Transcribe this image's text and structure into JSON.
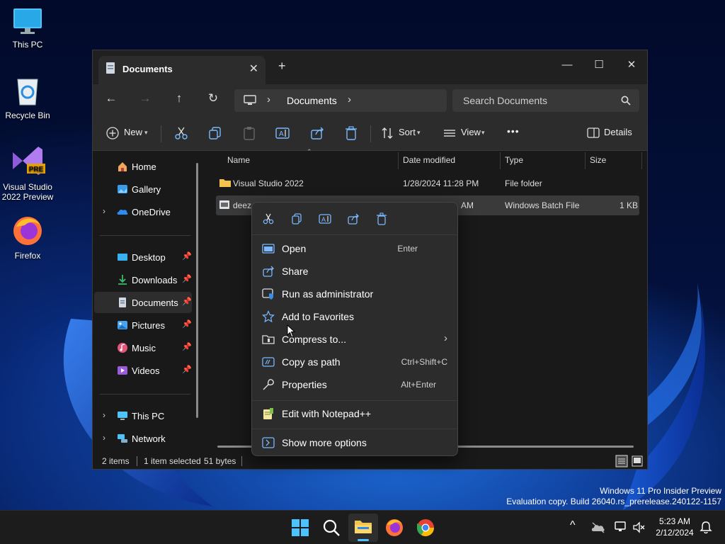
{
  "desktop": {
    "icons": [
      {
        "label": "This PC"
      },
      {
        "label": "Recycle Bin"
      },
      {
        "label": "Visual Studio 2022 Preview",
        "badge": "PRE"
      },
      {
        "label": "Firefox"
      }
    ],
    "watermark": {
      "line1": "Windows 11 Pro Insider Preview",
      "line2": "Evaluation copy. Build 26040.rs_prerelease.240122-1157"
    }
  },
  "window": {
    "tab_title": "Documents",
    "tab_close": "✕",
    "new_tab": "+",
    "controls": {
      "minimize": "—",
      "maximize": "☐",
      "close": "✕"
    },
    "nav": {
      "back": "←",
      "forward": "→",
      "up": "↑",
      "refresh": "↻"
    },
    "address": {
      "separator": "›",
      "current": "Documents"
    },
    "search": {
      "placeholder": "Search Documents"
    },
    "toolbar": {
      "new_label": "New",
      "sort_label": "Sort",
      "view_label": "View",
      "more_label": "•••",
      "details_label": "Details"
    },
    "sidebar": {
      "items": [
        {
          "label": "Home"
        },
        {
          "label": "Gallery"
        },
        {
          "label": "OneDrive"
        },
        {
          "label": "Desktop"
        },
        {
          "label": "Downloads"
        },
        {
          "label": "Documents"
        },
        {
          "label": "Pictures"
        },
        {
          "label": "Music"
        },
        {
          "label": "Videos"
        },
        {
          "label": "This PC"
        },
        {
          "label": "Network"
        }
      ]
    },
    "columns": {
      "name": "Name",
      "date": "Date modified",
      "type": "Type",
      "size": "Size"
    },
    "rows": [
      {
        "name": "Visual Studio 2022",
        "date": "1/28/2024 11:28 PM",
        "type": "File folder",
        "size": ""
      },
      {
        "name": "deez.",
        "date": "AM",
        "type": "Windows Batch File",
        "size": "1 KB"
      }
    ],
    "status": {
      "count": "2 items",
      "selected": "1 item selected",
      "bytes": "51 bytes"
    }
  },
  "context_menu": {
    "items": [
      {
        "label": "Open",
        "shortcut": "Enter",
        "icon": "open-icon"
      },
      {
        "label": "Share",
        "shortcut": "",
        "icon": "share-icon"
      },
      {
        "label": "Run as administrator",
        "shortcut": "",
        "icon": "admin-shield-icon"
      },
      {
        "label": "Add to Favorites",
        "shortcut": "",
        "icon": "star-icon"
      },
      {
        "label": "Compress to...",
        "shortcut": "›",
        "icon": "zip-folder-icon"
      },
      {
        "label": "Copy as path",
        "shortcut": "Ctrl+Shift+C",
        "icon": "path-icon"
      },
      {
        "label": "Properties",
        "shortcut": "Alt+Enter",
        "icon": "wrench-icon"
      },
      {
        "label": "Edit with Notepad++",
        "shortcut": "",
        "icon": "notepadpp-icon"
      },
      {
        "label": "Show more options",
        "shortcut": "",
        "icon": "more-options-icon"
      }
    ]
  },
  "taskbar": {
    "time": "5:23 AM",
    "date": "2/12/2024",
    "chevron": "^"
  },
  "colors": {
    "accent": "#4cc2ff",
    "window_bg": "#191919",
    "menu_bg": "#2c2c2c"
  }
}
